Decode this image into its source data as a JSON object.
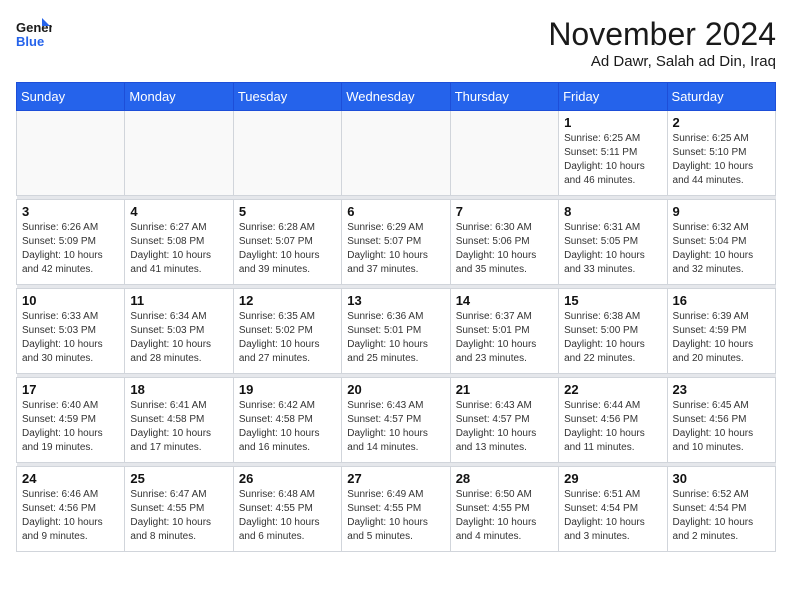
{
  "logo": {
    "line1": "General",
    "line2": "Blue"
  },
  "title": "November 2024",
  "location": "Ad Dawr, Salah ad Din, Iraq",
  "headers": [
    "Sunday",
    "Monday",
    "Tuesday",
    "Wednesday",
    "Thursday",
    "Friday",
    "Saturday"
  ],
  "weeks": [
    [
      {
        "day": "",
        "info": ""
      },
      {
        "day": "",
        "info": ""
      },
      {
        "day": "",
        "info": ""
      },
      {
        "day": "",
        "info": ""
      },
      {
        "day": "",
        "info": ""
      },
      {
        "day": "1",
        "info": "Sunrise: 6:25 AM\nSunset: 5:11 PM\nDaylight: 10 hours\nand 46 minutes."
      },
      {
        "day": "2",
        "info": "Sunrise: 6:25 AM\nSunset: 5:10 PM\nDaylight: 10 hours\nand 44 minutes."
      }
    ],
    [
      {
        "day": "3",
        "info": "Sunrise: 6:26 AM\nSunset: 5:09 PM\nDaylight: 10 hours\nand 42 minutes."
      },
      {
        "day": "4",
        "info": "Sunrise: 6:27 AM\nSunset: 5:08 PM\nDaylight: 10 hours\nand 41 minutes."
      },
      {
        "day": "5",
        "info": "Sunrise: 6:28 AM\nSunset: 5:07 PM\nDaylight: 10 hours\nand 39 minutes."
      },
      {
        "day": "6",
        "info": "Sunrise: 6:29 AM\nSunset: 5:07 PM\nDaylight: 10 hours\nand 37 minutes."
      },
      {
        "day": "7",
        "info": "Sunrise: 6:30 AM\nSunset: 5:06 PM\nDaylight: 10 hours\nand 35 minutes."
      },
      {
        "day": "8",
        "info": "Sunrise: 6:31 AM\nSunset: 5:05 PM\nDaylight: 10 hours\nand 33 minutes."
      },
      {
        "day": "9",
        "info": "Sunrise: 6:32 AM\nSunset: 5:04 PM\nDaylight: 10 hours\nand 32 minutes."
      }
    ],
    [
      {
        "day": "10",
        "info": "Sunrise: 6:33 AM\nSunset: 5:03 PM\nDaylight: 10 hours\nand 30 minutes."
      },
      {
        "day": "11",
        "info": "Sunrise: 6:34 AM\nSunset: 5:03 PM\nDaylight: 10 hours\nand 28 minutes."
      },
      {
        "day": "12",
        "info": "Sunrise: 6:35 AM\nSunset: 5:02 PM\nDaylight: 10 hours\nand 27 minutes."
      },
      {
        "day": "13",
        "info": "Sunrise: 6:36 AM\nSunset: 5:01 PM\nDaylight: 10 hours\nand 25 minutes."
      },
      {
        "day": "14",
        "info": "Sunrise: 6:37 AM\nSunset: 5:01 PM\nDaylight: 10 hours\nand 23 minutes."
      },
      {
        "day": "15",
        "info": "Sunrise: 6:38 AM\nSunset: 5:00 PM\nDaylight: 10 hours\nand 22 minutes."
      },
      {
        "day": "16",
        "info": "Sunrise: 6:39 AM\nSunset: 4:59 PM\nDaylight: 10 hours\nand 20 minutes."
      }
    ],
    [
      {
        "day": "17",
        "info": "Sunrise: 6:40 AM\nSunset: 4:59 PM\nDaylight: 10 hours\nand 19 minutes."
      },
      {
        "day": "18",
        "info": "Sunrise: 6:41 AM\nSunset: 4:58 PM\nDaylight: 10 hours\nand 17 minutes."
      },
      {
        "day": "19",
        "info": "Sunrise: 6:42 AM\nSunset: 4:58 PM\nDaylight: 10 hours\nand 16 minutes."
      },
      {
        "day": "20",
        "info": "Sunrise: 6:43 AM\nSunset: 4:57 PM\nDaylight: 10 hours\nand 14 minutes."
      },
      {
        "day": "21",
        "info": "Sunrise: 6:43 AM\nSunset: 4:57 PM\nDaylight: 10 hours\nand 13 minutes."
      },
      {
        "day": "22",
        "info": "Sunrise: 6:44 AM\nSunset: 4:56 PM\nDaylight: 10 hours\nand 11 minutes."
      },
      {
        "day": "23",
        "info": "Sunrise: 6:45 AM\nSunset: 4:56 PM\nDaylight: 10 hours\nand 10 minutes."
      }
    ],
    [
      {
        "day": "24",
        "info": "Sunrise: 6:46 AM\nSunset: 4:56 PM\nDaylight: 10 hours\nand 9 minutes."
      },
      {
        "day": "25",
        "info": "Sunrise: 6:47 AM\nSunset: 4:55 PM\nDaylight: 10 hours\nand 8 minutes."
      },
      {
        "day": "26",
        "info": "Sunrise: 6:48 AM\nSunset: 4:55 PM\nDaylight: 10 hours\nand 6 minutes."
      },
      {
        "day": "27",
        "info": "Sunrise: 6:49 AM\nSunset: 4:55 PM\nDaylight: 10 hours\nand 5 minutes."
      },
      {
        "day": "28",
        "info": "Sunrise: 6:50 AM\nSunset: 4:55 PM\nDaylight: 10 hours\nand 4 minutes."
      },
      {
        "day": "29",
        "info": "Sunrise: 6:51 AM\nSunset: 4:54 PM\nDaylight: 10 hours\nand 3 minutes."
      },
      {
        "day": "30",
        "info": "Sunrise: 6:52 AM\nSunset: 4:54 PM\nDaylight: 10 hours\nand 2 minutes."
      }
    ]
  ]
}
